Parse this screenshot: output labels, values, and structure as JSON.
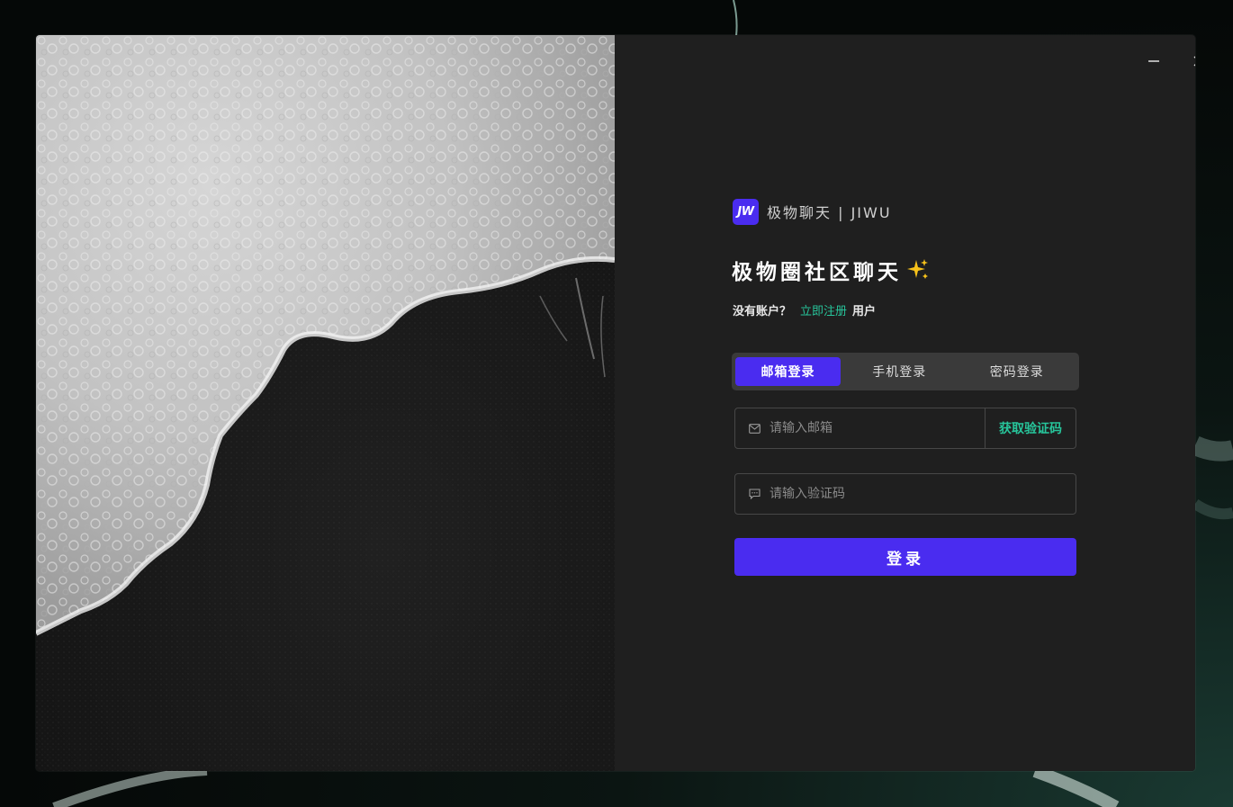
{
  "window": {
    "minimize_icon": "minimize-icon",
    "close_icon": "close-icon"
  },
  "brand": {
    "logo_text": "JW",
    "name": "极物聊天 | JIWU"
  },
  "headline": {
    "title": "极物圈社区聊天",
    "emoji": "sparkles-icon"
  },
  "register": {
    "prompt": "没有账户？",
    "link": "立即注册",
    "suffix": "用户"
  },
  "tabs": [
    {
      "label": "邮箱登录",
      "active": true
    },
    {
      "label": "手机登录",
      "active": false
    },
    {
      "label": "密码登录",
      "active": false
    }
  ],
  "form": {
    "email": {
      "placeholder": "请输入邮箱",
      "value": "",
      "icon": "mail-icon"
    },
    "get_code_label": "获取验证码",
    "code": {
      "placeholder": "请输入验证码",
      "value": "",
      "icon": "message-icon"
    },
    "submit_label": "登录"
  },
  "colors": {
    "accent": "#4a2cf0",
    "link": "#27c59b",
    "panel_bg": "#1f1f1f"
  }
}
